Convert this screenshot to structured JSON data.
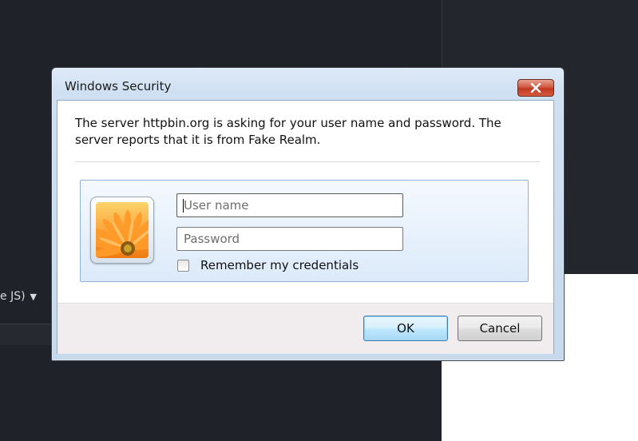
{
  "background": {
    "dropdown_label": "e JS)",
    "dropdown_caret": "▼"
  },
  "dialog": {
    "title": "Windows Security",
    "close_icon": "close-icon",
    "message": "The server httpbin.org is asking for your user name and password. The server reports that it is from Fake Realm.",
    "username": {
      "value": "",
      "placeholder": "User name"
    },
    "password": {
      "value": "",
      "placeholder": "Password"
    },
    "remember_label": "Remember my credentials",
    "remember_checked": false,
    "ok_label": "OK",
    "cancel_label": "Cancel",
    "accent_colors": {
      "close_button": "#c1381f",
      "ok_border": "#3c7fb1",
      "tile_border": "#8fb3d9"
    }
  }
}
